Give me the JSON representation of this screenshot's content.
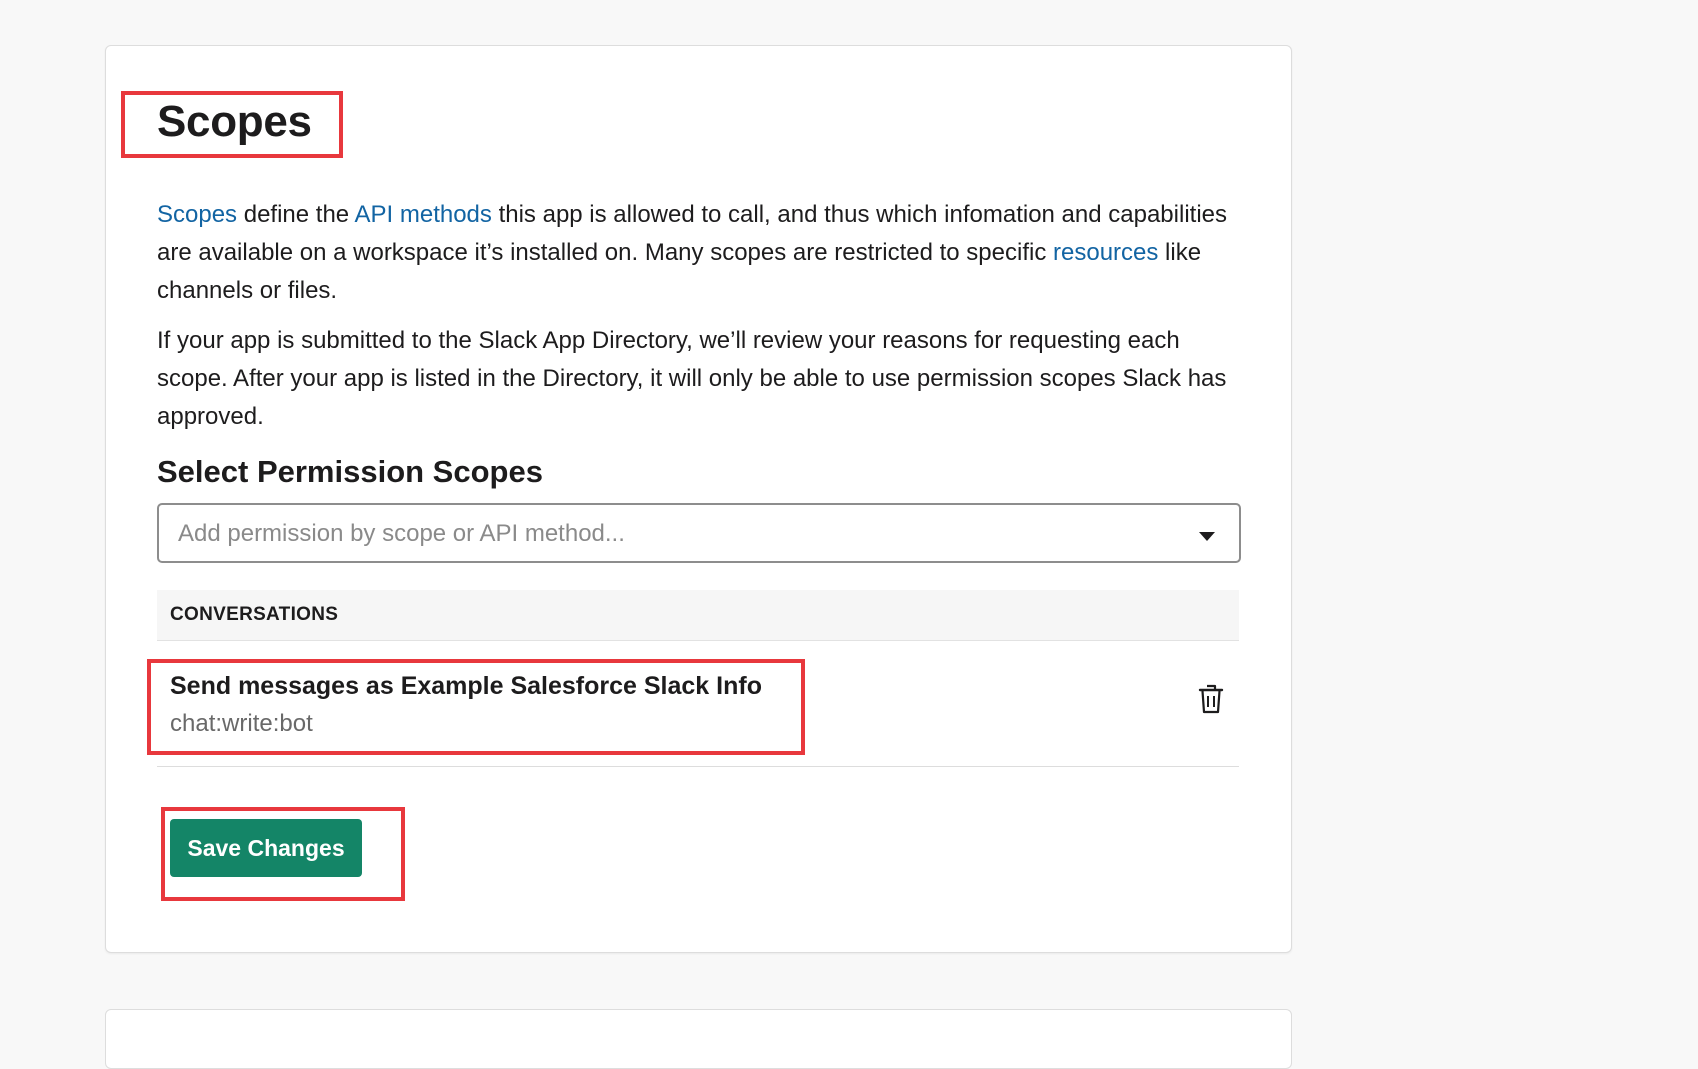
{
  "scopes_section": {
    "title": "Scopes",
    "intro": {
      "link_scopes": "Scopes",
      "text_1": " define the ",
      "link_api_methods": "API methods",
      "text_2": " this app is allowed to call, and thus which infomation and capabilities are available on a workspace it’s installed on. Many scopes are restricted to specific ",
      "link_resources": "resources",
      "text_3": " like channels or files."
    },
    "review_note": "If your app is submitted to the Slack App Directory, we’ll review your reasons for requesting each scope. After your app is listed in the Directory, it will only be able to use permission scopes Slack has approved.",
    "select_heading": "Select Permission Scopes",
    "select": {
      "placeholder": "Add permission by scope or API method...",
      "icon": "chevron-down-icon"
    },
    "groups": [
      {
        "header": "CONVERSATIONS",
        "scopes": [
          {
            "name": "Send messages as Example Salesforce Slack Info",
            "scope": "chat:write:bot",
            "remove_icon": "trash-icon"
          }
        ]
      }
    ],
    "save_label": "Save Changes"
  },
  "colors": {
    "link": "#1264a3",
    "primary_button": "#148567",
    "highlight_box": "#e8383d"
  }
}
